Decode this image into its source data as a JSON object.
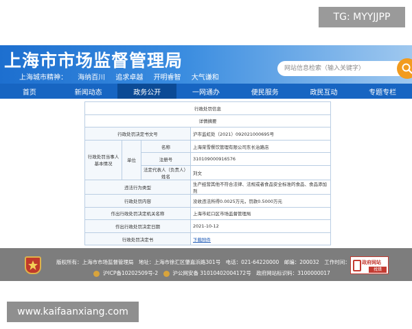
{
  "overlay": {
    "tg_label": "TG: MYYJJPP",
    "watermark": "www.kaifaanxiang.com"
  },
  "header": {
    "title": "上海市市场监督管理局",
    "spirit": [
      "上海城市精神：",
      "海纳百川",
      "追求卓越",
      "开明睿智",
      "大气谦和"
    ],
    "search_placeholder": "网站信息检索（输入关键字）",
    "colors": {
      "primary": "#1765c2",
      "search_button": "#f29b1e"
    }
  },
  "nav": {
    "items": [
      "首页",
      "新闻动态",
      "政务公开",
      "一网通办",
      "便民服务",
      "政民互动",
      "专题专栏"
    ],
    "active_index": 2
  },
  "table": {
    "title": "行政处罚信息",
    "subtitle": "详情摘要",
    "decision_no_label": "行政处罚决定书文号",
    "decision_no": "沪市监虹处（2021）092021000695号",
    "party_label": "行政处罚当事人基本情况",
    "unit_label": "单位",
    "name_label": "名称",
    "name_value": "上海荣雪餐饮管理有限公司东长治路店",
    "reg_label": "注册号",
    "reg_value": "310109000916576",
    "legal_rep_label": "法定代表人（负责人）姓名",
    "legal_rep_value": "刘文",
    "violation_type_label": "违法行为类型",
    "violation_type_value": "生产经营其他不符合法律、法规或者食品安全标准的食品、食品添加剂",
    "penalty_content_label": "行政处罚内容",
    "penalty_content_value": "没收违法所得0.0025万元，罚款0.5000万元",
    "authority_label": "作出行政处罚决定机关名称",
    "authority_value": "上海市虹口区市场监督管理局",
    "date_label": "作出行政处罚决定日期",
    "date_value": "2021-10-12",
    "document_label": "行政处罚决定书",
    "document_link": "下载附件"
  },
  "footer": {
    "line1": [
      "版权所有：上海市市场监督管理局",
      "地址：上海市徐汇区肇嘉浜路301号",
      "电话：021-64220000",
      "邮编：200032",
      "工作时间：9:00-17:30"
    ],
    "icp": "沪ICP备10202509号-2",
    "police": "沪公网安备 31010402004172号",
    "site_code": "政府网站标识码：3100000017",
    "gov_badge_top": "政府网站",
    "gov_badge_bottom": "找错"
  }
}
